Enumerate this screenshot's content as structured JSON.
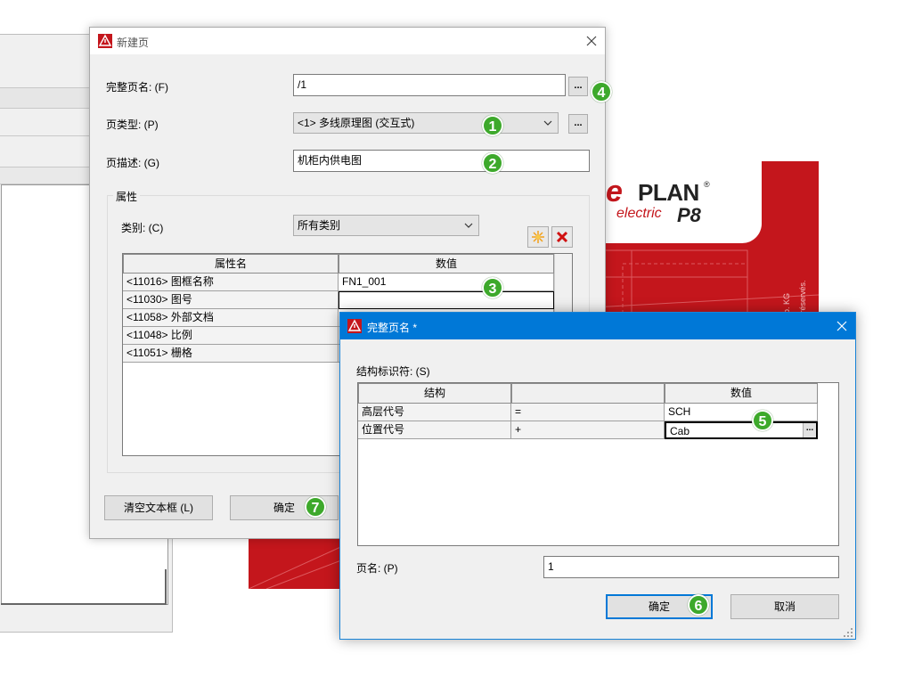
{
  "dialog_new_page": {
    "title": "新建页",
    "full_page_name_label": "完整页名: (F)",
    "full_page_name_value": "/1",
    "page_type_label": "页类型: (P)",
    "page_type_value": "<1> 多线原理图 (交互式)",
    "page_desc_label": "页描述: (G)",
    "page_desc_value": "机柜内供电图",
    "properties_group": "属性",
    "category_label": "类别: (C)",
    "category_value": "所有类别",
    "grid": {
      "headers": [
        "属性名",
        "数值"
      ],
      "rows": [
        {
          "name": "<11016> 图框名称",
          "value": "FN1_001"
        },
        {
          "name": "<11030> 图号",
          "value": ""
        },
        {
          "name": "<11058> 外部文档",
          "value": ""
        },
        {
          "name": "<11048> 比例",
          "value": ""
        },
        {
          "name": "<11051> 栅格",
          "value": ""
        }
      ]
    },
    "clear_button": "清空文本框 (L)",
    "ok_button": "确定",
    "dots": "..."
  },
  "dialog_full_page_name": {
    "title": "完整页名 *",
    "structure_label": "结构标识符: (S)",
    "grid": {
      "headers": [
        "结构",
        "",
        "数值"
      ],
      "rows": [
        {
          "structure": "高层代号",
          "prefix": "=",
          "value": "SCH"
        },
        {
          "structure": "位置代号",
          "prefix": "+",
          "value": "Cab"
        }
      ]
    },
    "page_name_label": "页名: (P)",
    "page_name_value": "1",
    "ok_button": "确定",
    "cancel_button": "取消",
    "dots": "..."
  },
  "splash": {
    "brand_e": "e",
    "brand_plan": "PLAN",
    "brand_reg": "®",
    "brand_electric": "electric",
    "brand_version": "P8",
    "copyright_line1": "H & Co. KG",
    "copyright_line2": "droits réservés."
  },
  "badges": [
    "1",
    "2",
    "3",
    "4",
    "5",
    "6",
    "7"
  ],
  "colors": {
    "badge": "#3da92b",
    "eplan_red": "#c4161c",
    "title_active": "#0078d7"
  }
}
